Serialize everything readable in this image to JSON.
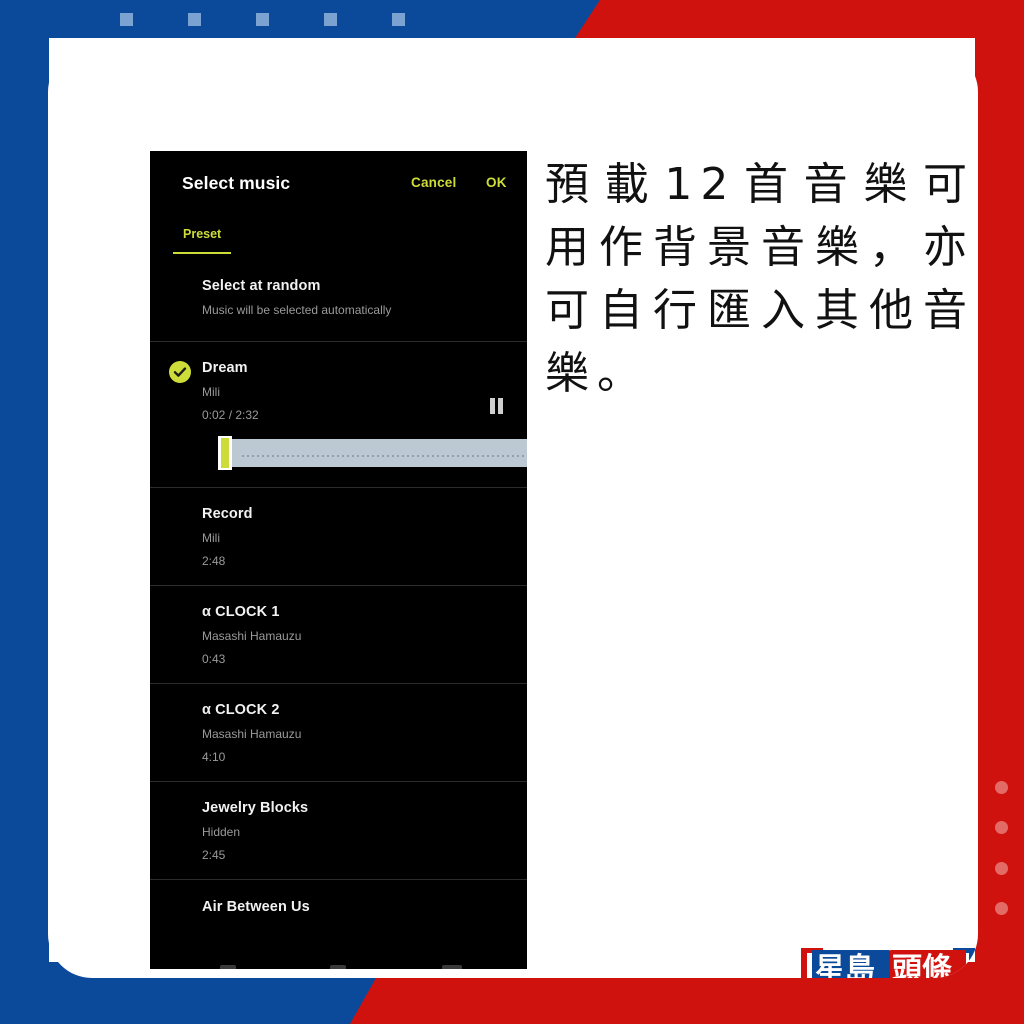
{
  "page": {
    "caption": "預載12首音樂可用作背景音樂，亦可自行匯入其他音樂。",
    "brand_logo_text": "星島頭條",
    "colors": {
      "brand_blue": "#0b4a9b",
      "brand_red": "#d0120f",
      "accent_lime": "#cddc39",
      "panel_black": "#000000",
      "waveform": "#bcc8d2"
    }
  },
  "phone": {
    "header": {
      "title": "Select music",
      "cancel_label": "Cancel",
      "ok_label": "OK"
    },
    "tabs": [
      {
        "label": "Preset",
        "selected": true
      }
    ],
    "random_option": {
      "title": "Select at random",
      "subtitle": "Music will be selected automatically"
    },
    "tracks": [
      {
        "title": "Dream",
        "artist": "Mili",
        "time": "0:02 / 2:32",
        "selected": true,
        "playing": true,
        "transport_icon": "pause-icon",
        "progress_percent": 1
      },
      {
        "title": "Record",
        "artist": "Mili",
        "time": "2:48",
        "selected": false
      },
      {
        "title": "α CLOCK 1",
        "artist": "Masashi Hamauzu",
        "time": "0:43",
        "selected": false
      },
      {
        "title": "α CLOCK 2",
        "artist": "Masashi Hamauzu",
        "time": "4:10",
        "selected": false
      },
      {
        "title": "Jewelry Blocks",
        "artist": "Hidden",
        "time": "2:45",
        "selected": false
      },
      {
        "title": "Air Between Us",
        "artist": "",
        "time": "",
        "selected": false,
        "partially_visible": true
      }
    ]
  }
}
